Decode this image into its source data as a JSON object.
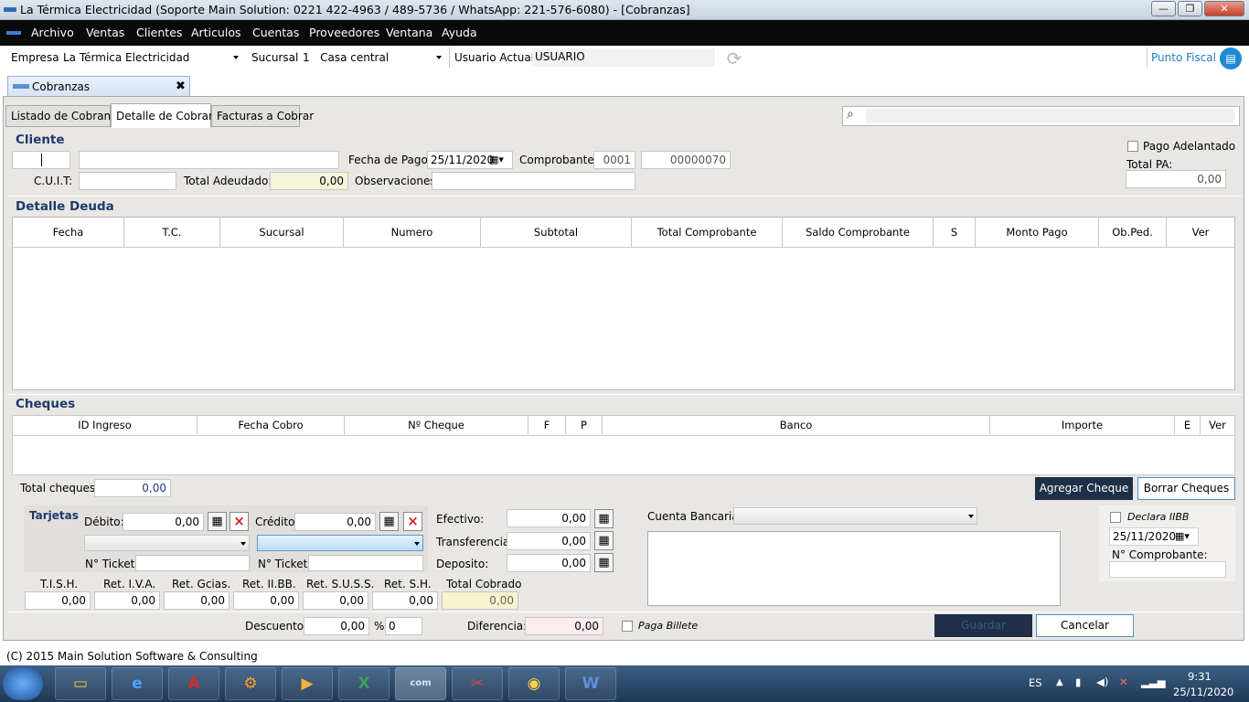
{
  "window": {
    "title": "La Térmica Electricidad (Soporte Main Solution: 0221 422-4963 / 489-5736 / WhatsApp: 221-576-6080) - [Cobranzas]",
    "min_label": "—",
    "max_label": "❐",
    "close_label": "✕"
  },
  "menu": [
    "Archivo",
    "Ventas",
    "Clientes",
    "Articulos",
    "Cuentas",
    "Proveedores",
    "Ventana",
    "Ayuda"
  ],
  "toolbar": {
    "empresa_label": "Empresa:",
    "empresa_value": "La Térmica Electricidad",
    "sucursal_label": "Sucursal:",
    "sucursal_num": "1",
    "sucursal_value": "Casa central",
    "usuario_label": "Usuario Actual:",
    "usuario_value": "USUARIO",
    "punto_fiscal": "Punto Fiscal",
    "accent_color": "#1e7bc6"
  },
  "doc_tab": {
    "label": "Cobranzas",
    "close": "✖"
  },
  "tabs": [
    "Listado de Cobranzas",
    "Detalle de Cobranza",
    "Facturas a Cobrar"
  ],
  "cliente": {
    "section": "Cliente",
    "fecha_pago_label": "Fecha de Pago:",
    "fecha_pago": "25/11/2020",
    "comprobante_label": "Comprobante:",
    "comprobante_pv": "0001",
    "comprobante_num": "00000070",
    "cuit_label": "C.U.I.T:",
    "total_adeudado_label": "Total Adeudado:",
    "total_adeudado": "0,00",
    "observaciones_label": "Observaciones:",
    "pago_adelantado_label": "Pago Adelantado",
    "total_pa_label": "Total PA:",
    "total_pa": "0,00"
  },
  "detalle_deuda": {
    "section": "Detalle Deuda",
    "columns": [
      "Fecha",
      "T.C.",
      "Sucursal",
      "Numero",
      "Subtotal",
      "Total Comprobante",
      "Saldo Comprobante",
      "S",
      "Monto Pago",
      "Ob.Ped.",
      "Ver"
    ]
  },
  "cheques": {
    "section": "Cheques",
    "columns": [
      "ID Ingreso",
      "Fecha Cobro",
      "Nº Cheque",
      "F",
      "P",
      "Banco",
      "Importe",
      "E",
      "Ver"
    ],
    "total_label": "Total cheques:",
    "total_value": "0,00",
    "agregar": "Agregar Cheque",
    "borrar": "Borrar Cheques"
  },
  "tarjetas": {
    "section": "Tarjetas",
    "debito_label": "Débito:",
    "debito": "0,00",
    "credito_label": "Crédito:",
    "credito": "0,00",
    "ticket_label": "N° Ticket:"
  },
  "pagos": {
    "efectivo_label": "Efectivo:",
    "efectivo": "0,00",
    "transferencia_label": "Transferencia:",
    "transferencia": "0,00",
    "deposito_label": "Deposito:",
    "deposito": "0,00",
    "cuenta_label": "Cuenta Bancaria:"
  },
  "iibb": {
    "declara_label": "Declara IIBB",
    "fecha": "25/11/2020",
    "comprobante_label": "N° Comprobante:"
  },
  "retenciones": {
    "labels": [
      "T.I.S.H.",
      "Ret. I.V.A.",
      "Ret. Gcias.",
      "Ret. II.BB.",
      "Ret. S.U.S.S.",
      "Ret. S.H.",
      "Total Cobrado"
    ],
    "values": [
      "0,00",
      "0,00",
      "0,00",
      "0,00",
      "0,00",
      "0,00",
      "0,00"
    ]
  },
  "footer": {
    "descuento_label": "Descuento:",
    "descuento": "0,00",
    "pct_label": "%",
    "pct": "0",
    "diferencia_label": "Diferencia:",
    "diferencia": "0,00",
    "paga_billete": "Paga Billete",
    "guardar": "Guardar",
    "cancelar": "Cancelar"
  },
  "status": "(C) 2015 Main Solution Software & Consulting",
  "taskbar": {
    "lang": "ES",
    "time": "9:31",
    "date": "25/11/2020",
    "apps": [
      "explorer-icon",
      "ie-icon",
      "autocad-icon",
      "app-orange-icon",
      "media-icon",
      "excel-icon",
      "mainsolution-icon",
      "snip-icon",
      "chrome-icon",
      "word-icon"
    ]
  }
}
